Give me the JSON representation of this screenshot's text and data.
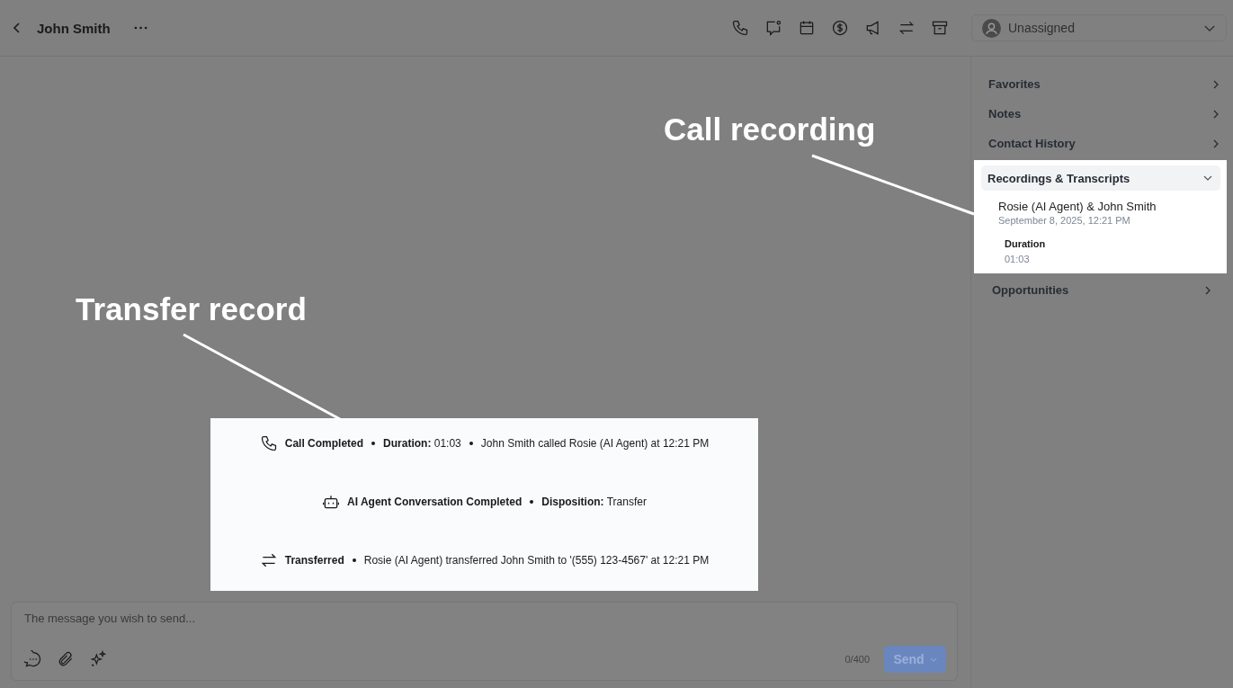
{
  "header": {
    "title": "John Smith",
    "assignee": {
      "label": "Unassigned"
    }
  },
  "sidebar": {
    "sections": [
      {
        "label": "Favorites",
        "expanded": false
      },
      {
        "label": "Notes",
        "expanded": false
      },
      {
        "label": "Contact History",
        "expanded": false
      },
      {
        "label": "Recordings & Transcripts",
        "expanded": true,
        "recording": {
          "title": "Rosie (AI Agent) & John Smith",
          "date": "September 8, 2025, 12:21 PM",
          "duration_label": "Duration",
          "duration": "01:03"
        }
      },
      {
        "label": "Opportunities",
        "expanded": false
      }
    ]
  },
  "timeline": [
    {
      "kind": "call",
      "title": "Call Completed",
      "details": [
        "**Duration:** 01:03",
        "John Smith called Rosie (AI Agent) at 12:21 PM"
      ]
    },
    {
      "kind": "ai",
      "title": "AI Agent Conversation Completed",
      "details": [
        "**Disposition:** Transfer"
      ]
    },
    {
      "kind": "transfer",
      "title": "Transferred",
      "details": [
        "Rosie (AI Agent) transferred John Smith to '(555) 123-4567' at 12:21 PM"
      ]
    }
  ],
  "composer": {
    "placeholder": "The message you wish to send...",
    "counter": "0/400",
    "send": "Send"
  },
  "annotations": [
    {
      "text": "Call recording"
    },
    {
      "text": "Transfer record"
    }
  ]
}
